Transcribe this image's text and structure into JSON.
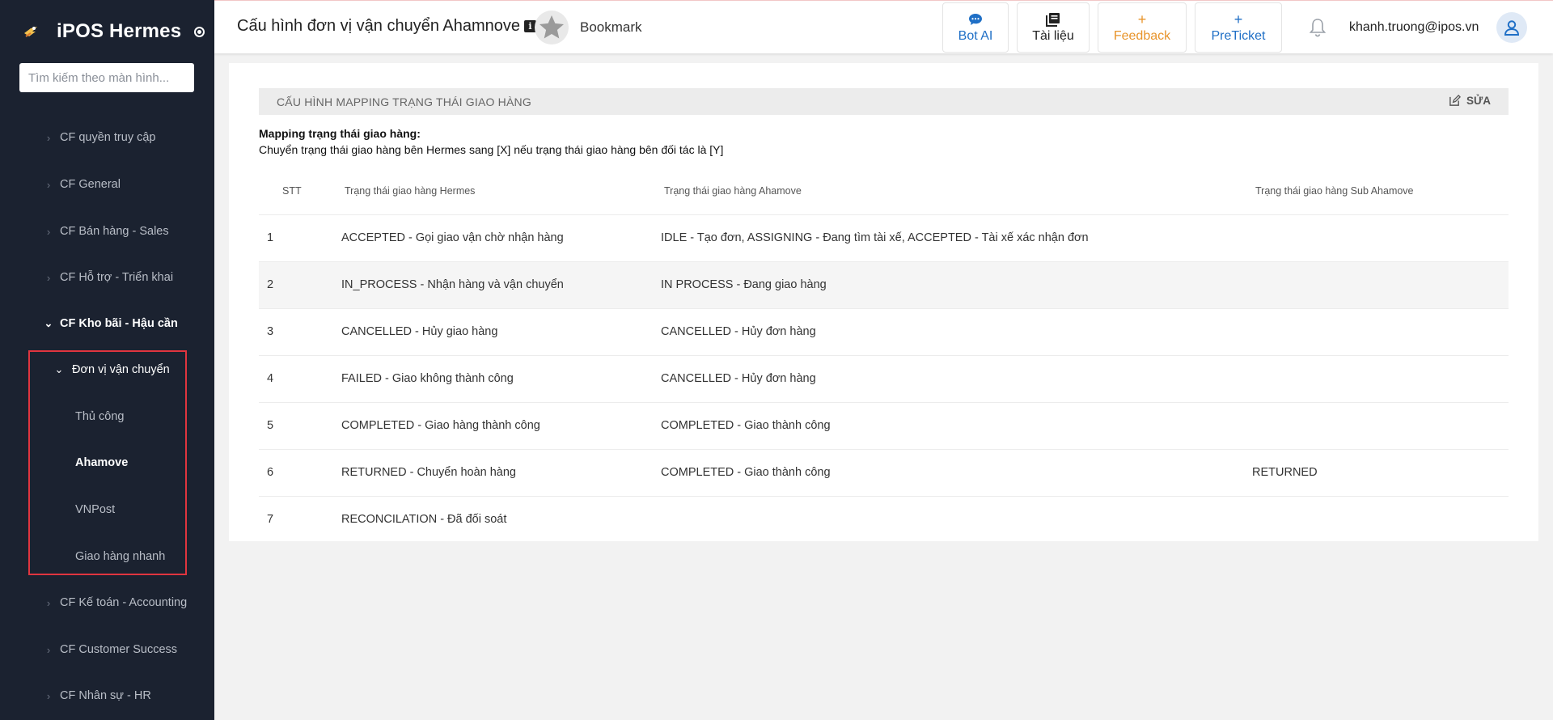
{
  "sidebar": {
    "brand": "iPOS Hermes",
    "search_placeholder": "Tìm kiếm theo màn hình...",
    "items": [
      {
        "label": "CF quyền truy cập"
      },
      {
        "label": "CF General"
      },
      {
        "label": "CF Bán hàng - Sales"
      },
      {
        "label": "CF Hỗ trợ - Triển khai"
      },
      {
        "label": "CF Kho bãi - Hậu cần"
      },
      {
        "label": "Đơn vị vận chuyển"
      },
      {
        "label": "Thủ công"
      },
      {
        "label": "Ahamove"
      },
      {
        "label": "VNPost"
      },
      {
        "label": "Giao hàng nhanh"
      },
      {
        "label": "CF Kế toán - Accounting"
      },
      {
        "label": "CF Customer Success"
      },
      {
        "label": "CF Nhân sự - HR"
      }
    ]
  },
  "header": {
    "title": "Cấu hình đơn vị vận chuyển Ahamnove",
    "bookmark": "Bookmark",
    "buttons": {
      "bot_ai": "Bot AI",
      "docs": "Tài liệu",
      "feedback": "Feedback",
      "preticket": "PreTicket"
    },
    "user_email": "khanh.truong@ipos.vn"
  },
  "main": {
    "section_title": "CẤU HÌNH MAPPING TRẠNG THÁI GIAO HÀNG",
    "edit_label": "SỬA",
    "desc_title": "Mapping trạng thái giao hàng:",
    "desc_text": "Chuyển trạng thái giao hàng bên Hermes sang [X] nếu trạng thái giao hàng bên đối tác là [Y]",
    "columns": [
      "STT",
      "Trạng thái giao hàng Hermes",
      "Trạng thái giao hàng Ahamove",
      "Trạng thái giao hàng Sub Ahamove"
    ],
    "rows": [
      [
        "1",
        "ACCEPTED - Gọi giao vận chờ nhận hàng",
        "IDLE - Tạo đơn, ASSIGNING - Đang tìm tài xế, ACCEPTED - Tài xế xác nhận đơn",
        ""
      ],
      [
        "2",
        "IN_PROCESS - Nhận hàng và vận chuyển",
        "IN PROCESS - Đang giao hàng",
        ""
      ],
      [
        "3",
        "CANCELLED - Hủy giao hàng",
        "CANCELLED - Hủy đơn hàng",
        ""
      ],
      [
        "4",
        "FAILED - Giao không thành công",
        "CANCELLED - Hủy đơn hàng",
        ""
      ],
      [
        "5",
        "COMPLETED - Giao hàng thành công",
        "COMPLETED - Giao thành công",
        ""
      ],
      [
        "6",
        "RETURNED - Chuyển hoàn hàng",
        "COMPLETED - Giao thành công",
        "RETURNED"
      ],
      [
        "7",
        "RECONCILATION - Đã đối soát",
        "",
        ""
      ]
    ]
  }
}
